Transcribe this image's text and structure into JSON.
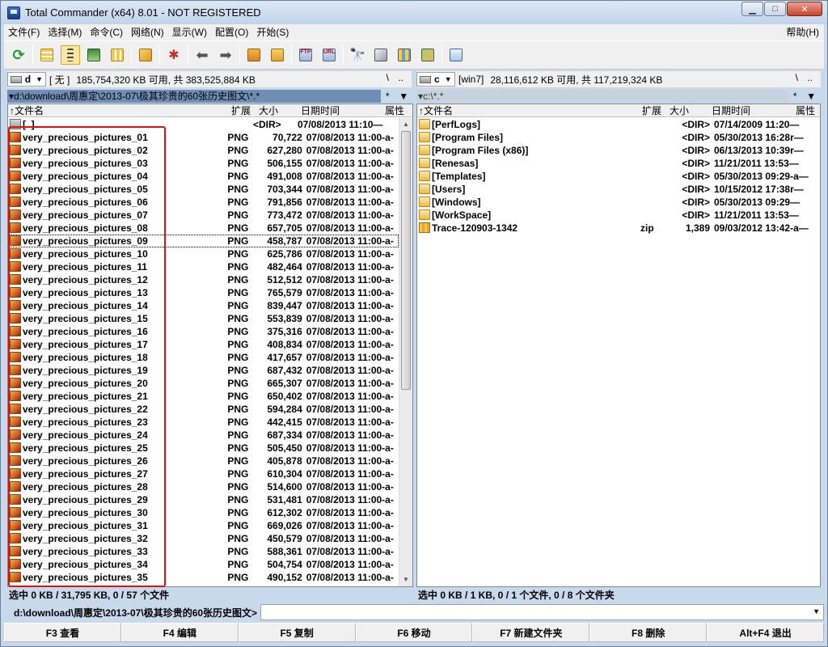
{
  "window": {
    "title": "Total Commander (x64) 8.01 - NOT REGISTERED"
  },
  "menu": {
    "items": [
      "文件(F)",
      "选择(M)",
      "命令(C)",
      "网络(N)",
      "显示(W)",
      "配置(O)",
      "开始(S)"
    ],
    "help": "帮助(H)"
  },
  "left": {
    "drive": "d",
    "drive_label": "[ 无 ]",
    "drive_info": "185,754,320 KB 可用, 共 383,525,884 KB",
    "root": "\\",
    "up": "..",
    "path": "▾d:\\download\\周惠定\\2013-07\\极其珍贵的60张历史图文\\*.*",
    "hist": "*",
    "headers": {
      "name": "↑文件名",
      "ext": "扩展",
      "size": "大小",
      "date": "日期时间",
      "attr": "属性"
    },
    "parent": {
      "name": "[..]",
      "size": "<DIR>",
      "date": "07/08/2013 11:10—"
    },
    "files": [
      {
        "name": "very_precious_pictures_01",
        "ext": "PNG",
        "size": "70,722",
        "date": "07/08/2013 11:00-a-"
      },
      {
        "name": "very_precious_pictures_02",
        "ext": "PNG",
        "size": "627,280",
        "date": "07/08/2013 11:00-a-"
      },
      {
        "name": "very_precious_pictures_03",
        "ext": "PNG",
        "size": "506,155",
        "date": "07/08/2013 11:00-a-"
      },
      {
        "name": "very_precious_pictures_04",
        "ext": "PNG",
        "size": "491,008",
        "date": "07/08/2013 11:00-a-"
      },
      {
        "name": "very_precious_pictures_05",
        "ext": "PNG",
        "size": "703,344",
        "date": "07/08/2013 11:00-a-"
      },
      {
        "name": "very_precious_pictures_06",
        "ext": "PNG",
        "size": "791,856",
        "date": "07/08/2013 11:00-a-"
      },
      {
        "name": "very_precious_pictures_07",
        "ext": "PNG",
        "size": "773,472",
        "date": "07/08/2013 11:00-a-"
      },
      {
        "name": "very_precious_pictures_08",
        "ext": "PNG",
        "size": "657,705",
        "date": "07/08/2013 11:00-a-"
      },
      {
        "name": "very_precious_pictures_09",
        "ext": "PNG",
        "size": "458,787",
        "date": "07/08/2013 11:00-a-"
      },
      {
        "name": "very_precious_pictures_10",
        "ext": "PNG",
        "size": "625,786",
        "date": "07/08/2013 11:00-a-"
      },
      {
        "name": "very_precious_pictures_11",
        "ext": "PNG",
        "size": "482,464",
        "date": "07/08/2013 11:00-a-"
      },
      {
        "name": "very_precious_pictures_12",
        "ext": "PNG",
        "size": "512,512",
        "date": "07/08/2013 11:00-a-"
      },
      {
        "name": "very_precious_pictures_13",
        "ext": "PNG",
        "size": "765,579",
        "date": "07/08/2013 11:00-a-"
      },
      {
        "name": "very_precious_pictures_14",
        "ext": "PNG",
        "size": "839,447",
        "date": "07/08/2013 11:00-a-"
      },
      {
        "name": "very_precious_pictures_15",
        "ext": "PNG",
        "size": "553,839",
        "date": "07/08/2013 11:00-a-"
      },
      {
        "name": "very_precious_pictures_16",
        "ext": "PNG",
        "size": "375,316",
        "date": "07/08/2013 11:00-a-"
      },
      {
        "name": "very_precious_pictures_17",
        "ext": "PNG",
        "size": "408,834",
        "date": "07/08/2013 11:00-a-"
      },
      {
        "name": "very_precious_pictures_18",
        "ext": "PNG",
        "size": "417,657",
        "date": "07/08/2013 11:00-a-"
      },
      {
        "name": "very_precious_pictures_19",
        "ext": "PNG",
        "size": "687,432",
        "date": "07/08/2013 11:00-a-"
      },
      {
        "name": "very_precious_pictures_20",
        "ext": "PNG",
        "size": "665,307",
        "date": "07/08/2013 11:00-a-"
      },
      {
        "name": "very_precious_pictures_21",
        "ext": "PNG",
        "size": "650,402",
        "date": "07/08/2013 11:00-a-"
      },
      {
        "name": "very_precious_pictures_22",
        "ext": "PNG",
        "size": "594,284",
        "date": "07/08/2013 11:00-a-"
      },
      {
        "name": "very_precious_pictures_23",
        "ext": "PNG",
        "size": "442,415",
        "date": "07/08/2013 11:00-a-"
      },
      {
        "name": "very_precious_pictures_24",
        "ext": "PNG",
        "size": "687,334",
        "date": "07/08/2013 11:00-a-"
      },
      {
        "name": "very_precious_pictures_25",
        "ext": "PNG",
        "size": "505,450",
        "date": "07/08/2013 11:00-a-"
      },
      {
        "name": "very_precious_pictures_26",
        "ext": "PNG",
        "size": "405,878",
        "date": "07/08/2013 11:00-a-"
      },
      {
        "name": "very_precious_pictures_27",
        "ext": "PNG",
        "size": "610,304",
        "date": "07/08/2013 11:00-a-"
      },
      {
        "name": "very_precious_pictures_28",
        "ext": "PNG",
        "size": "514,600",
        "date": "07/08/2013 11:00-a-"
      },
      {
        "name": "very_precious_pictures_29",
        "ext": "PNG",
        "size": "531,481",
        "date": "07/08/2013 11:00-a-"
      },
      {
        "name": "very_precious_pictures_30",
        "ext": "PNG",
        "size": "612,302",
        "date": "07/08/2013 11:00-a-"
      },
      {
        "name": "very_precious_pictures_31",
        "ext": "PNG",
        "size": "669,026",
        "date": "07/08/2013 11:00-a-"
      },
      {
        "name": "very_precious_pictures_32",
        "ext": "PNG",
        "size": "450,579",
        "date": "07/08/2013 11:00-a-"
      },
      {
        "name": "very_precious_pictures_33",
        "ext": "PNG",
        "size": "588,361",
        "date": "07/08/2013 11:00-a-"
      },
      {
        "name": "very_precious_pictures_34",
        "ext": "PNG",
        "size": "504,754",
        "date": "07/08/2013 11:00-a-"
      },
      {
        "name": "very_precious_pictures_35",
        "ext": "PNG",
        "size": "490,152",
        "date": "07/08/2013 11:00-a-"
      }
    ],
    "status": "选中 0 KB / 31,795 KB, 0 / 57 个文件"
  },
  "right": {
    "drive": "c",
    "drive_label": "[win7]",
    "drive_info": "28,116,612 KB 可用, 共 117,219,324 KB",
    "root": "\\",
    "up": "..",
    "path": "▾c:\\*.*",
    "hist": "*",
    "headers": {
      "name": "↑文件名",
      "ext": "扩展",
      "size": "大小",
      "date": "日期时间",
      "attr": "属性"
    },
    "files": [
      {
        "type": "folder",
        "name": "[PerfLogs]",
        "ext": "",
        "size": "<DIR>",
        "date": "07/14/2009 11:20—"
      },
      {
        "type": "folder",
        "name": "[Program Files]",
        "ext": "",
        "size": "<DIR>",
        "date": "05/30/2013 16:28r—"
      },
      {
        "type": "folder",
        "name": "[Program Files (x86)]",
        "ext": "",
        "size": "<DIR>",
        "date": "06/13/2013 10:39r—"
      },
      {
        "type": "folder",
        "name": "[Renesas]",
        "ext": "",
        "size": "<DIR>",
        "date": "11/21/2011 13:53—"
      },
      {
        "type": "folder",
        "name": "[Templates]",
        "ext": "",
        "size": "<DIR>",
        "date": "05/30/2013 09:29-a—"
      },
      {
        "type": "folder",
        "name": "[Users]",
        "ext": "",
        "size": "<DIR>",
        "date": "10/15/2012 17:38r—"
      },
      {
        "type": "folder",
        "name": "[Windows]",
        "ext": "",
        "size": "<DIR>",
        "date": "05/30/2013 09:29—"
      },
      {
        "type": "folder",
        "name": "[WorkSpace]",
        "ext": "",
        "size": "<DIR>",
        "date": "11/21/2011 13:53—"
      },
      {
        "type": "zip",
        "name": "Trace-120903-1342",
        "ext": "zip",
        "size": "1,389",
        "date": "09/03/2012 13:42-a—"
      }
    ],
    "status": "选中 0 KB / 1 KB, 0 / 1 个文件, 0 / 8 个文件夹"
  },
  "cmdline": {
    "prompt": "d:\\download\\周惠定\\2013-07\\极其珍贵的60张历史图文>"
  },
  "fkeys": [
    "F3 查看",
    "F4 编辑",
    "F5 复制",
    "F6 移动",
    "F7 新建文件夹",
    "F8 删除",
    "Alt+F4 退出"
  ]
}
